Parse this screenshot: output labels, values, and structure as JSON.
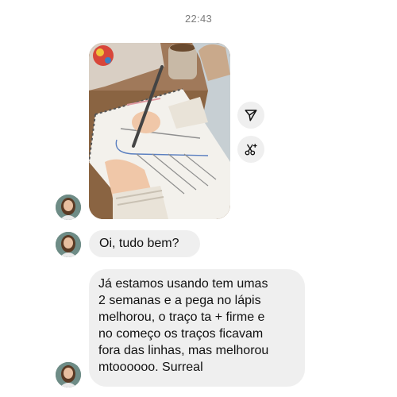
{
  "timestamp": "22:43",
  "photo": {
    "icon": "photo-child-writing"
  },
  "actions": {
    "share_icon": "send-icon",
    "cut_icon": "scissors-sparkle-icon"
  },
  "messages": [
    {
      "text": "Oi, tudo bem?"
    },
    {
      "text": "Já estamos usando tem umas\n2 semanas e a pega no lápis\nmelhorou, o traço ta + firme e\nno começo os traços ficavam\nfora das linhas, mas melhorou\nmtoooooo. Surreal"
    }
  ],
  "colors": {
    "bubble_bg": "#efefef",
    "timestamp": "#7c7c7c",
    "background": "#ffffff"
  }
}
